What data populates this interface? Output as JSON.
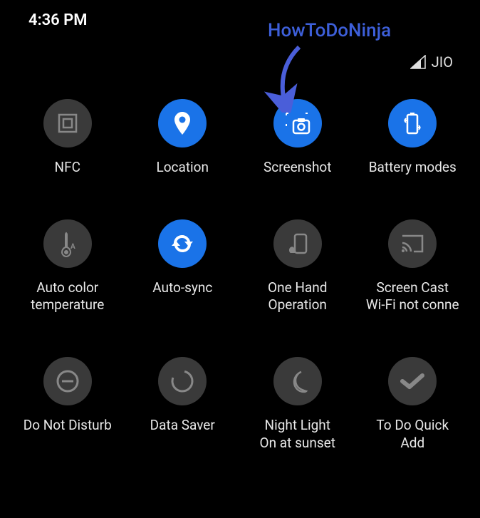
{
  "status": {
    "time": "4:36 PM",
    "carrier": "JIO"
  },
  "annotation": {
    "text": "HowToDoNinja"
  },
  "tiles": [
    {
      "label": "NFC",
      "active": false,
      "icon": "nfc"
    },
    {
      "label": "Location",
      "active": true,
      "icon": "location"
    },
    {
      "label": "Screenshot",
      "active": true,
      "icon": "screenshot"
    },
    {
      "label": "Battery modes",
      "active": true,
      "icon": "battery"
    },
    {
      "label": "Auto color\ntemperature",
      "active": false,
      "icon": "thermometer"
    },
    {
      "label": "Auto-sync",
      "active": true,
      "icon": "sync"
    },
    {
      "label": "One Hand\nOperation",
      "active": false,
      "icon": "onehand"
    },
    {
      "label": "Screen Cast\nWi-Fi not conne",
      "active": false,
      "icon": "cast"
    },
    {
      "label": "Do Not Disturb",
      "active": false,
      "icon": "dnd"
    },
    {
      "label": "Data Saver",
      "active": false,
      "icon": "datasaver"
    },
    {
      "label": "Night Light\nOn at sunset",
      "active": false,
      "icon": "nightlight"
    },
    {
      "label": "To Do Quick\nAdd",
      "active": false,
      "icon": "todo"
    }
  ],
  "colors": {
    "active": "#1a73e8",
    "inactive": "#3a3a3a",
    "annotation": "#3d5fd9"
  }
}
